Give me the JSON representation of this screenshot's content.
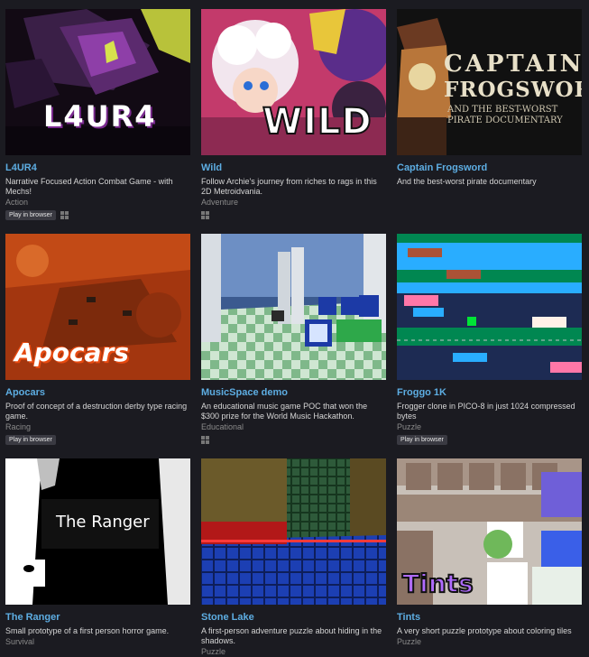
{
  "games": [
    {
      "title": "L4UR4",
      "description": "Narrative Focused Action Combat Game - with Mechs!",
      "genre": "Action",
      "play_label": "Play in browser",
      "windows_icon": "windows-icon",
      "logo_text": "L4UR4"
    },
    {
      "title": "Wild",
      "description": "Follow Archie's journey from riches to rags in this 2D Metroidvania.",
      "genre": "Adventure",
      "windows_icon": "windows-icon",
      "logo_text": "WILD"
    },
    {
      "title": "Captain Frogsword",
      "description": "And the best-worst pirate documentary",
      "logo_line1": "CAPTAIN",
      "logo_line2": "FROGSWORD",
      "logo_line3": "AND THE BEST-WORST",
      "logo_line4": "PIRATE DOCUMENTARY"
    },
    {
      "title": "Apocars",
      "description": "Proof of concept of a destruction derby type racing game.",
      "genre": "Racing",
      "play_label": "Play in browser",
      "logo_text": "Apocars"
    },
    {
      "title": "MusicSpace demo",
      "description": "An educational music game POC that won the $300 prize for the World Music Hackathon.",
      "genre": "Educational",
      "windows_icon": "windows-icon"
    },
    {
      "title": "Froggo 1K",
      "description": "Frogger clone in PICO-8 in just 1024 compressed bytes",
      "genre": "Puzzle",
      "play_label": "Play in browser"
    },
    {
      "title": "The Ranger",
      "description": "Small prototype of a first person horror game.",
      "genre": "Survival",
      "logo_text": "The Ranger"
    },
    {
      "title": "Stone Lake",
      "description": "A first-person adventure puzzle about hiding in the shadows.",
      "genre": "Puzzle"
    },
    {
      "title": "Tints",
      "description": "A very short puzzle prototype about coloring tiles",
      "genre": "Puzzle",
      "logo_text": "Tints"
    }
  ],
  "colors": {
    "background": "#1b1b21",
    "title_link": "#5dade2",
    "genre_text": "#8a8a8a"
  }
}
